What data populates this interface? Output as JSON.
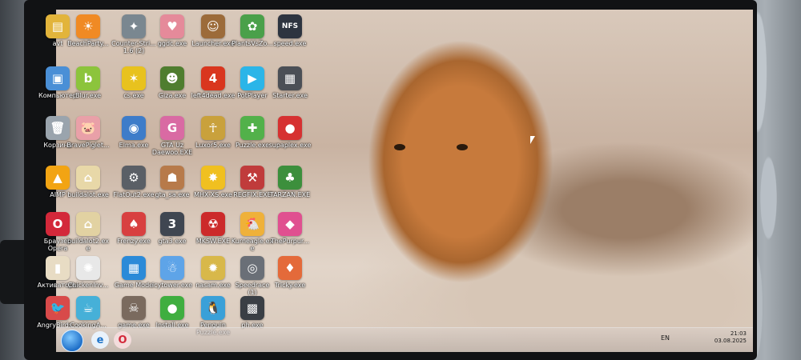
{
  "desktop": {
    "icons": [
      {
        "label": "avt",
        "glyph": "▤",
        "color": "#e2b43b"
      },
      {
        "label": "BeachParty...",
        "glyph": "☀",
        "color": "#f08a24"
      },
      {
        "label": "Counter-Stri... 1.6 (2)",
        "glyph": "✦",
        "color": "#7a8790"
      },
      {
        "label": "ggdc.exe",
        "glyph": "♥",
        "color": "#e58a9a"
      },
      {
        "label": "Launcher.exe",
        "glyph": "☺",
        "color": "#9c6b3a"
      },
      {
        "label": "PlantsVsZo...",
        "glyph": "✿",
        "color": "#4aa04a"
      },
      {
        "label": "speed.exe",
        "glyph": "NFS",
        "color": "#2d3440"
      },
      {
        "label": "Компьютер",
        "glyph": "▣",
        "color": "#4a8fd6"
      },
      {
        "label": "Blur.exe",
        "glyph": "b",
        "color": "#8cc43c"
      },
      {
        "label": "cs.exe",
        "glyph": "✶",
        "color": "#e8c21e"
      },
      {
        "label": "Giza.exe",
        "glyph": "☻",
        "color": "#4f7d2f"
      },
      {
        "label": "left4dead.exe",
        "glyph": "4",
        "color": "#d9361e"
      },
      {
        "label": "PotPlayer",
        "glyph": "▶",
        "color": "#2bb5e8"
      },
      {
        "label": "Starter.exe",
        "glyph": "▦",
        "color": "#4b4f56"
      },
      {
        "label": "Корзина",
        "glyph": "🗑",
        "color": "#9aa4ad"
      },
      {
        "label": "BravePiglet...",
        "glyph": "🐷",
        "color": "#e9a0a8"
      },
      {
        "label": "Elma.exe",
        "glyph": "◉",
        "color": "#3d7cc9"
      },
      {
        "label": "GTA Uz Daewoo.EXE",
        "glyph": "G",
        "color": "#d96aa3"
      },
      {
        "label": "Luxor5.exe",
        "glyph": "☥",
        "color": "#c9a13c"
      },
      {
        "label": "Puzzle.exe",
        "glyph": "✚",
        "color": "#52b14a"
      },
      {
        "label": "supaplex.exe",
        "glyph": "●",
        "color": "#d63131"
      },
      {
        "label": "AIMP",
        "glyph": "▲",
        "color": "#f2a413"
      },
      {
        "label": "buildalot.exe",
        "glyph": "⌂",
        "color": "#e8d8a8"
      },
      {
        "label": "FlatOut2.exe",
        "glyph": "⚙",
        "color": "#5a5f66"
      },
      {
        "label": "gta_sa.exe",
        "glyph": "☗",
        "color": "#b77a4a"
      },
      {
        "label": "MHX-XS.exe",
        "glyph": "✸",
        "color": "#f0c020"
      },
      {
        "label": "REGFIX.EXE",
        "glyph": "⚒",
        "color": "#c03b3b"
      },
      {
        "label": "TARZAN.EXE",
        "glyph": "♣",
        "color": "#3c8f3c"
      },
      {
        "label": "Браузер Opera",
        "glyph": "O",
        "color": "#d3283a"
      },
      {
        "label": "buildalot2.exe",
        "glyph": "⌂",
        "color": "#e2d2a2"
      },
      {
        "label": "Frenzy.exe",
        "glyph": "♠",
        "color": "#d84040"
      },
      {
        "label": "gta3.exe",
        "glyph": "3",
        "color": "#3f4651"
      },
      {
        "label": "MKSW.EXE",
        "glyph": "☢",
        "color": "#cc2a2a"
      },
      {
        "label": "Kurneagle.exe",
        "glyph": "🐔",
        "color": "#efb13a"
      },
      {
        "label": "ThePurpur...",
        "glyph": "◆",
        "color": "#e05090"
      },
      {
        "label": "Активаторы",
        "glyph": "▮",
        "color": "#e8dcc4"
      },
      {
        "label": "ChickenInv...",
        "glyph": "✺",
        "color": "#e8e8e8"
      },
      {
        "label": "Game Mode",
        "glyph": "▦",
        "color": "#2b8ad8"
      },
      {
        "label": "icytower.exe",
        "glyph": "☃",
        "color": "#5ea4e8"
      },
      {
        "label": "nasam.exe",
        "glyph": "✹",
        "color": "#d8b84a"
      },
      {
        "label": "Speedrace (1)",
        "glyph": "◎",
        "color": "#6a6f77"
      },
      {
        "label": "Tricky.exe",
        "glyph": "♦",
        "color": "#e46a3a"
      },
      {
        "label": "AngryBirds...",
        "glyph": "🐦",
        "color": "#d84a4a"
      },
      {
        "label": "CookingA...",
        "glyph": "☕",
        "color": "#46b0d8"
      },
      {
        "label": "game.exe",
        "glyph": "☠",
        "color": "#7a6a5e"
      },
      {
        "label": "Install.exe",
        "glyph": "●",
        "color": "#3fae3f"
      },
      {
        "label": "Penguin Puzzle.exe",
        "glyph": "🐧",
        "color": "#3aa0d8"
      },
      {
        "label": "ph.exe",
        "glyph": "▩",
        "color": "#3a3f45"
      }
    ]
  },
  "taskbar": {
    "language": "EN",
    "time": "21:03",
    "date": "03.08.2025"
  }
}
